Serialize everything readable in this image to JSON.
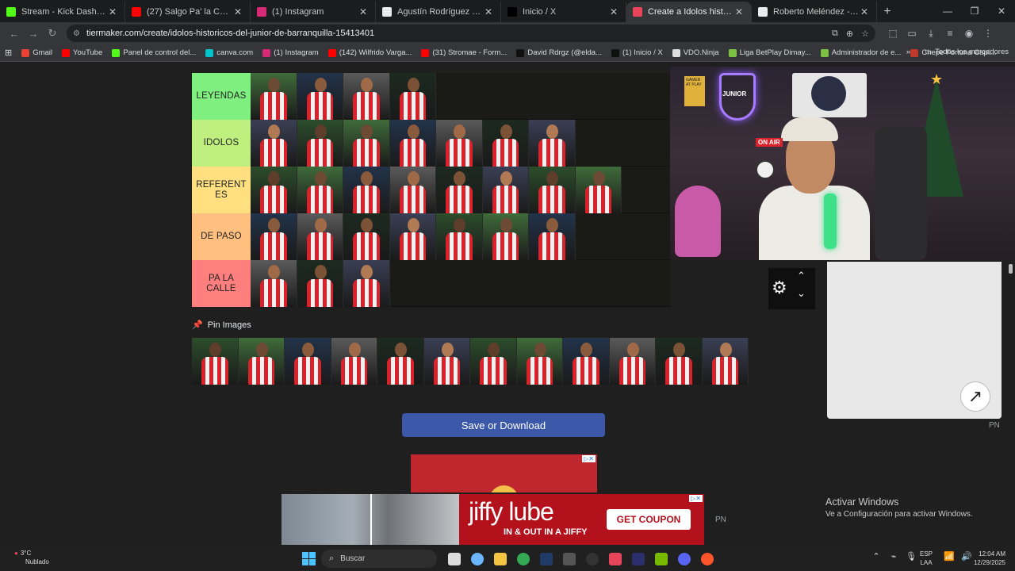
{
  "tabs": [
    {
      "label": "Stream - Kick Dashboard",
      "color": "#53fc18",
      "active": false
    },
    {
      "label": "(27) Salgo Pa' la Calle - YouTub...",
      "color": "#ff0000",
      "active": false
    },
    {
      "label": "(1) Instagram",
      "color": "#d62976",
      "active": false
    },
    {
      "label": "Agustín Rodríguez Rosano - W...",
      "color": "#e8eaed",
      "active": false
    },
    {
      "label": "Inicio / X",
      "color": "#000000",
      "active": false
    },
    {
      "label": "Create a Idolos historicos del Ju...",
      "color": "#e8445a",
      "active": true
    },
    {
      "label": "Roberto Meléndez - Wikipedia...",
      "color": "#e8eaed",
      "active": false
    }
  ],
  "browser": {
    "url": "tiermaker.com/create/idolos-historicos-del-junior-de-barranquilla-15413401"
  },
  "bookmarks": [
    {
      "label": "Gmail",
      "color": "#ea4335"
    },
    {
      "label": "YouTube",
      "color": "#ff0000"
    },
    {
      "label": "Panel de control del...",
      "color": "#53fc18"
    },
    {
      "label": "canva.com",
      "color": "#00c4cc"
    },
    {
      "label": "(1) Instagram",
      "color": "#d62976"
    },
    {
      "label": "(142) Wilfrido Varga...",
      "color": "#ff0000"
    },
    {
      "label": "(31) Stromae - Form...",
      "color": "#ff0000"
    },
    {
      "label": "David Rdrgz (@elda...",
      "color": "#111111"
    },
    {
      "label": "(1) Inicio / X",
      "color": "#111111"
    },
    {
      "label": "VDO.Ninja",
      "color": "#dddddd"
    },
    {
      "label": "Liga BetPlay Dimay...",
      "color": "#7cc242"
    },
    {
      "label": "Administrador de e...",
      "color": "#7cc242"
    },
    {
      "label": "Chepe Fortuna Capí...",
      "color": "#c0392b"
    }
  ],
  "bookmarks_more": "Todos los marcadores",
  "tiers": [
    {
      "label": "LEYENDAS",
      "color": "#7ff07f",
      "count": 4
    },
    {
      "label": "IDOLOS",
      "color": "#bff07f",
      "count": 7
    },
    {
      "label": "REFERENT ES",
      "color": "#ffdf80",
      "count": 8
    },
    {
      "label": "DE PASO",
      "color": "#ffbf7f",
      "count": 7
    },
    {
      "label": "PA LA CALLE",
      "color": "#ff7f7f",
      "count": 3
    }
  ],
  "pin_images_label": "Pin Images",
  "pin_count": 12,
  "save_button": "Save or Download",
  "ads": {
    "jiffy_brand": "jiffy lube",
    "jiffy_tagline": "IN & OUT IN A JIFFY",
    "jiffy_button": "GET COUPON",
    "pn_small": "PN",
    "pn_bottom": "PN"
  },
  "webcam": {
    "neon_label": "JUNIOR",
    "on_air": "ON AIR",
    "sign": "GAMER AT PLAY"
  },
  "watermark": {
    "title": "Activar Windows",
    "subtitle": "Ve a Configuración para activar Windows."
  },
  "taskbar": {
    "weather_temp": "3°C",
    "weather_desc": "Nublado",
    "search_placeholder": "Buscar",
    "lang_top": "ESP",
    "lang_bottom": "LAA",
    "time": "12:04 AM",
    "date": "12/29/2025"
  }
}
